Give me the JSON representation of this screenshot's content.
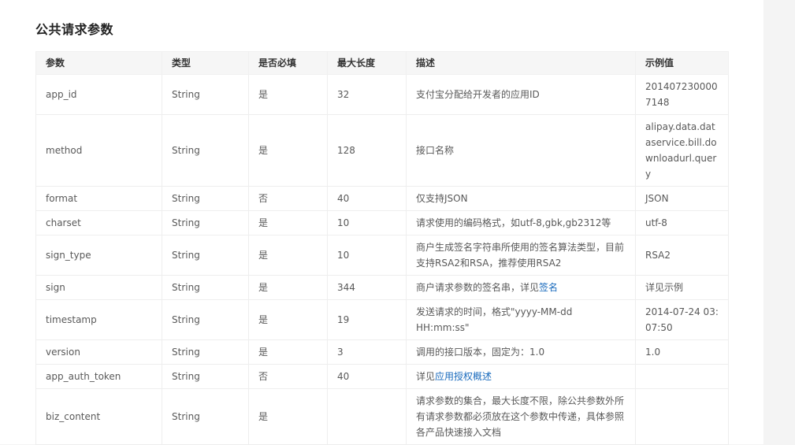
{
  "section_title": "公共请求参数",
  "columns": [
    "参数",
    "类型",
    "是否必填",
    "最大长度",
    "描述",
    "示例值"
  ],
  "rows": [
    {
      "param": "app_id",
      "type": "String",
      "required": "是",
      "max_len": "32",
      "desc_text": "支付宝分配给开发者的应用ID",
      "desc_link": "",
      "desc_after": "",
      "example": "2014072300007148"
    },
    {
      "param": "method",
      "type": "String",
      "required": "是",
      "max_len": "128",
      "desc_text": "接口名称",
      "desc_link": "",
      "desc_after": "",
      "example": "alipay.data.dataservice.bill.downloadurl.query"
    },
    {
      "param": "format",
      "type": "String",
      "required": "否",
      "max_len": "40",
      "desc_text": "仅支持JSON",
      "desc_link": "",
      "desc_after": "",
      "example": "JSON"
    },
    {
      "param": "charset",
      "type": "String",
      "required": "是",
      "max_len": "10",
      "desc_text": "请求使用的编码格式，如utf-8,gbk,gb2312等",
      "desc_link": "",
      "desc_after": "",
      "example": "utf-8"
    },
    {
      "param": "sign_type",
      "type": "String",
      "required": "是",
      "max_len": "10",
      "desc_text": "商户生成签名字符串所使用的签名算法类型，目前支持RSA2和RSA，推荐使用RSA2",
      "desc_link": "",
      "desc_after": "",
      "example": "RSA2"
    },
    {
      "param": "sign",
      "type": "String",
      "required": "是",
      "max_len": "344",
      "desc_text": "商户请求参数的签名串，详见",
      "desc_link": "签名",
      "desc_after": "",
      "example": "详见示例"
    },
    {
      "param": "timestamp",
      "type": "String",
      "required": "是",
      "max_len": "19",
      "desc_text": "发送请求的时间，格式\"yyyy-MM-dd HH:mm:ss\"",
      "desc_link": "",
      "desc_after": "",
      "example": "2014-07-24 03:07:50"
    },
    {
      "param": "version",
      "type": "String",
      "required": "是",
      "max_len": "3",
      "desc_text": "调用的接口版本，固定为：1.0",
      "desc_link": "",
      "desc_after": "",
      "example": "1.0"
    },
    {
      "param": "app_auth_token",
      "type": "String",
      "required": "否",
      "max_len": "40",
      "desc_text": "详见",
      "desc_link": "应用授权概述",
      "desc_after": "",
      "example": ""
    },
    {
      "param": "biz_content",
      "type": "String",
      "required": "是",
      "max_len": "",
      "desc_text": "请求参数的集合，最大长度不限，除公共参数外所有请求参数都必须放在这个参数中传递，具体参照各产品快速接入文档",
      "desc_link": "",
      "desc_after": "",
      "example": ""
    }
  ]
}
